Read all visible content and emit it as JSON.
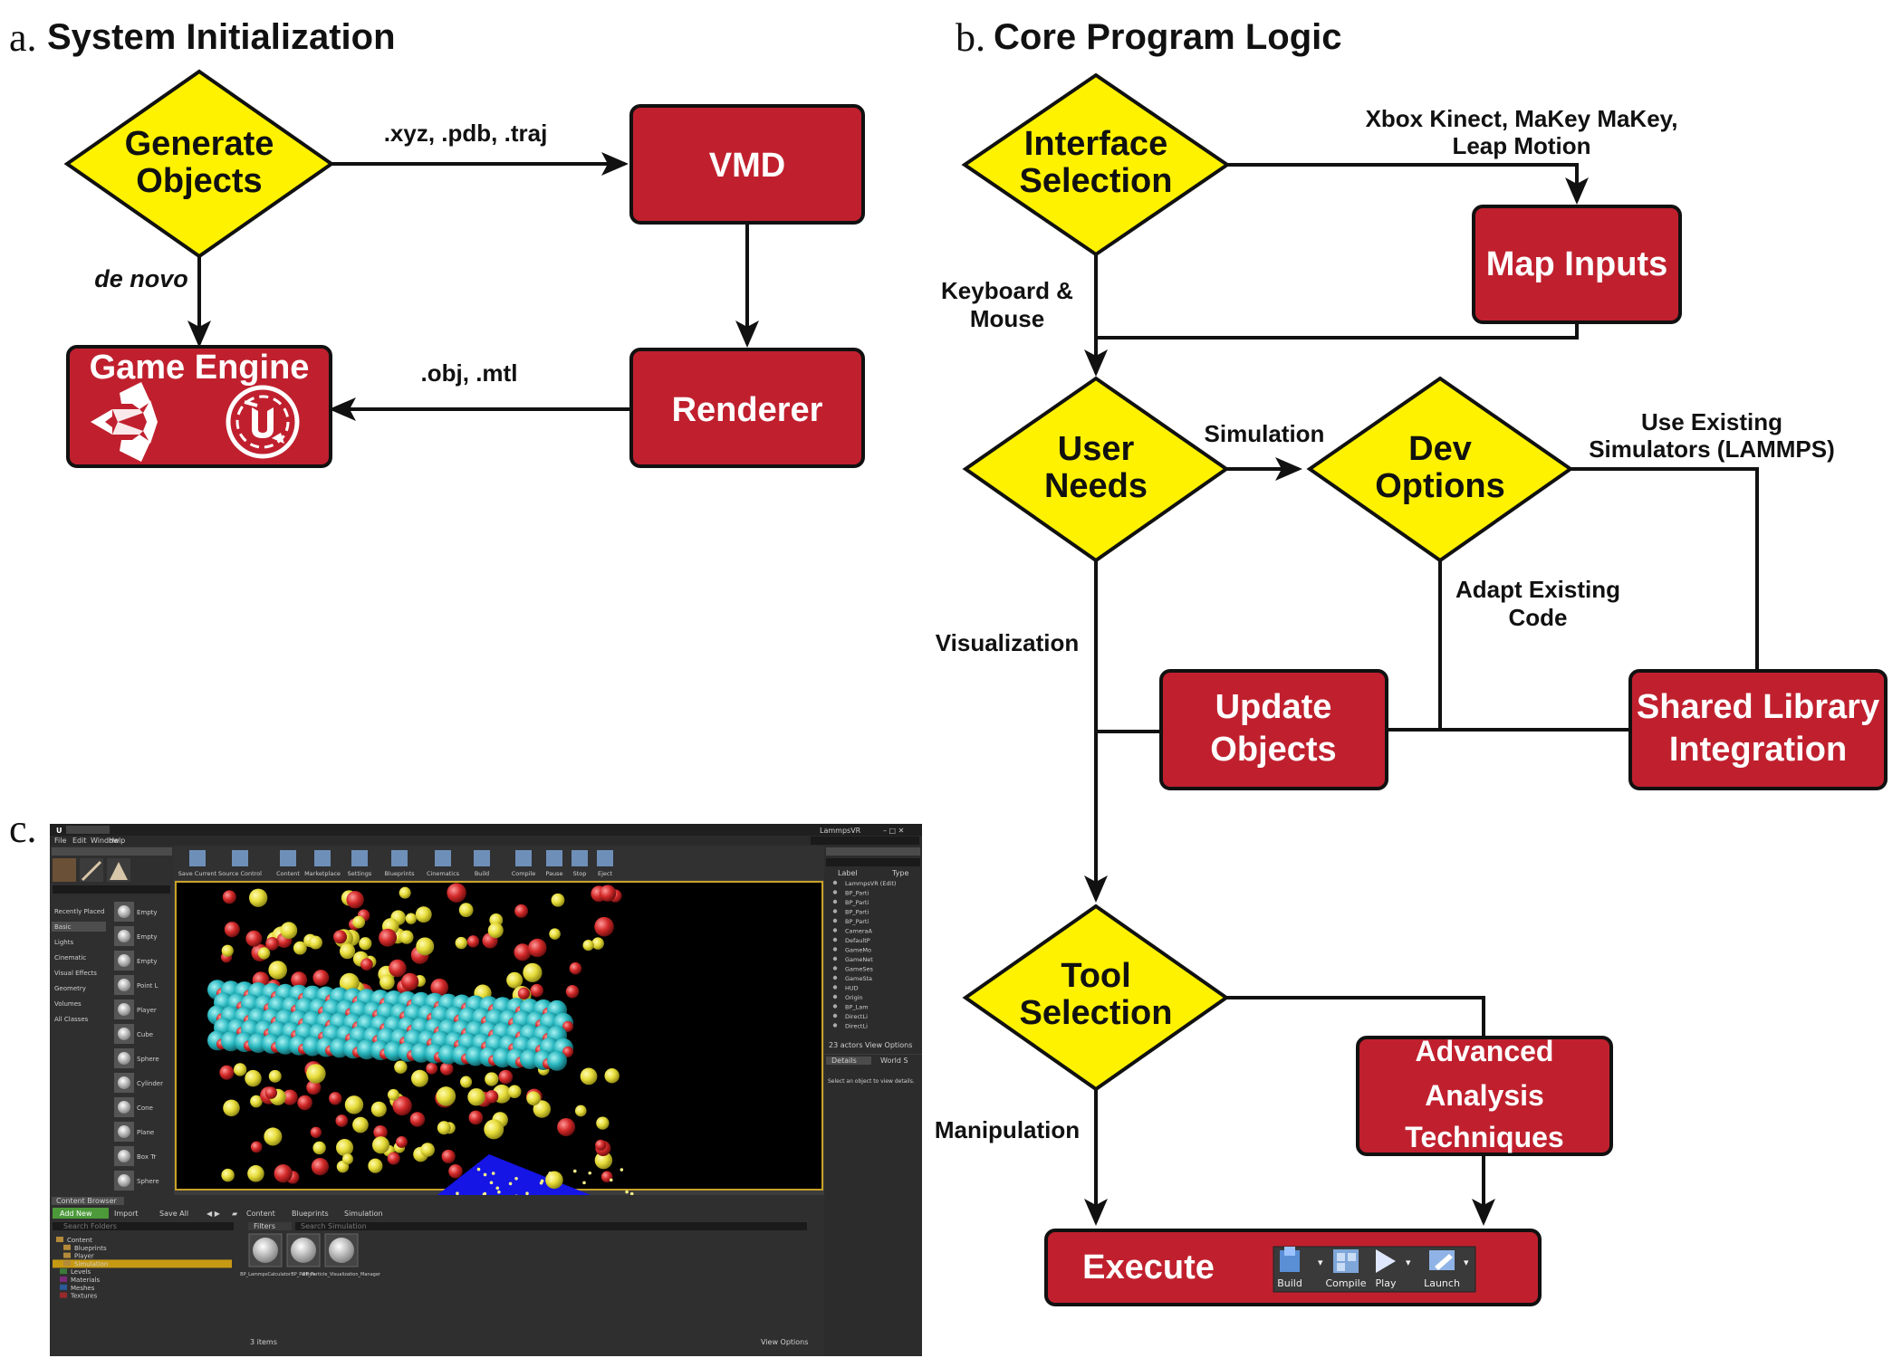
{
  "panels": {
    "a": {
      "letter": "a.",
      "title": "System Initialization"
    },
    "b": {
      "letter": "b.",
      "title": "Core Program Logic"
    },
    "c": {
      "letter": "c."
    }
  },
  "diagram_a": {
    "nodes": {
      "generate_objects": [
        "Generate",
        "Objects"
      ],
      "vmd": "VMD",
      "renderer": "Renderer",
      "game_engine": "Game Engine"
    },
    "edges": {
      "formats_xyz": ".xyz, .pdb, .traj",
      "de_novo": "de novo",
      "formats_obj": ".obj, .mtl"
    },
    "logos": [
      "unity-logo-icon",
      "unreal-engine-logo-icon"
    ]
  },
  "diagram_b": {
    "nodes": {
      "interface_selection": [
        "Interface",
        "Selection"
      ],
      "map_inputs": "Map Inputs",
      "user_needs": [
        "User",
        "Needs"
      ],
      "dev_options": [
        "Dev",
        "Options"
      ],
      "update_objects": [
        "Update",
        "Objects"
      ],
      "shared_library": [
        "Shared Library",
        "Integration"
      ],
      "tool_selection": [
        "Tool",
        "Selection"
      ],
      "advanced_analysis": [
        "Advanced",
        "Analysis",
        "Techniques"
      ],
      "execute": "Execute"
    },
    "edges": {
      "devices": [
        "Xbox Kinect, MaKey MaKey,",
        "Leap Motion"
      ],
      "keyboard_mouse": [
        "Keyboard &",
        "Mouse"
      ],
      "simulation": "Simulation",
      "use_existing": [
        "Use Existing",
        "Simulators (LAMMPS)"
      ],
      "adapt_existing": [
        "Adapt Existing",
        "Code"
      ],
      "visualization": "Visualization",
      "manipulation": "Manipulation"
    },
    "execute_toolbar": [
      "Build",
      "Compile",
      "Play",
      "Launch"
    ]
  },
  "editor_c": {
    "menu": [
      "File",
      "Edit",
      "Window",
      "Help"
    ],
    "project_name": "LammpsVR",
    "toolbar": [
      "Save Current",
      "Source Control",
      "Content",
      "Marketplace",
      "Settings",
      "Blueprints",
      "Cinematics",
      "Build",
      "Compile",
      "Pause",
      "Stop",
      "Eject"
    ],
    "place_categories": [
      "Recently Placed",
      "Basic",
      "Lights",
      "Cinematic",
      "Visual Effects",
      "Geometry",
      "Volumes",
      "All Classes"
    ],
    "place_items": [
      "Empty",
      "Empty",
      "Empty",
      "Point L",
      "Player",
      "Cube",
      "Sphere",
      "Cylinder",
      "Cone",
      "Plane",
      "Box Tr",
      "Sphere"
    ],
    "outliner_header": [
      "Label",
      "Type"
    ],
    "outliner_rows": [
      "LammpsVR (Edit)",
      "BP_Parti",
      "BP_Parti",
      "BP_Parti",
      "BP_Parti",
      "CameraA",
      "DefaultP",
      "GameMo",
      "GameNet",
      "GameSes",
      "GameSta",
      "HUD",
      "Origin",
      "BP_Lam",
      "DirectLi",
      "DirectLi"
    ],
    "outliner_footer": [
      "23 actors",
      "View Options"
    ],
    "details_tabs": [
      "Details",
      "World S"
    ],
    "details_hint": "Select an object to view details.",
    "content_browser": {
      "tab": "Content Browser",
      "add_new": "Add New",
      "import": "Import",
      "save_all": "Save All",
      "path": [
        "Content",
        "Blueprints",
        "Simulation"
      ],
      "search_paths": "Search Folders",
      "filters": "Filters",
      "search_sim": "Search Simulation",
      "tree": [
        "Content",
        "Blueprints",
        "Player",
        "Simulation",
        "Levels",
        "Materials",
        "Meshes",
        "Textures"
      ],
      "assets": [
        "BP_LammpsCalculator",
        "BP_Particle",
        "BP_Particle_Visualization_Manager"
      ],
      "item_count": "3 items",
      "view_options": "View Options"
    }
  },
  "colors": {
    "diamond_fill": "#fef200",
    "box_fill": "#c0202e",
    "line": "#111111",
    "atom_teal": "#2ab8c0",
    "atom_red": "#d42a2a",
    "atom_yellow": "#e6dc3a",
    "plane_blue": "#1515e6"
  }
}
